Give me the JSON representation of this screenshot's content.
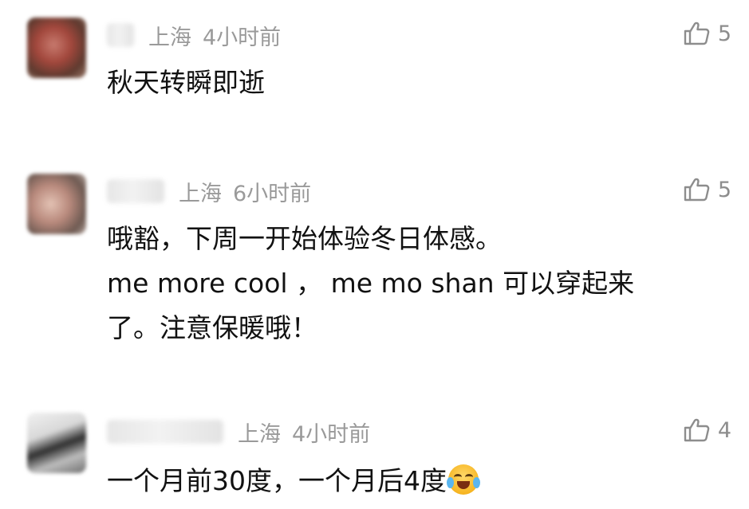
{
  "comments": [
    {
      "location": "上海",
      "time": "4小时前",
      "likes": "5",
      "text": "秋天转瞬即逝"
    },
    {
      "location": "上海",
      "time": "6小时前",
      "likes": "5",
      "text": "哦豁，下周一开始体验冬日体感。\nme more cool ， me mo shan 可以穿起来\n了。注意保暖哦！"
    },
    {
      "location": "上海",
      "time": "4小时前",
      "likes": "4",
      "text": "一个月前30度，一个月后4度"
    }
  ],
  "icons": {
    "like": "thumbs-up-icon",
    "emoji": "crying-laughing-emoji-icon"
  },
  "colors": {
    "meta_gray": "#9a9a9a",
    "text": "#111111"
  }
}
